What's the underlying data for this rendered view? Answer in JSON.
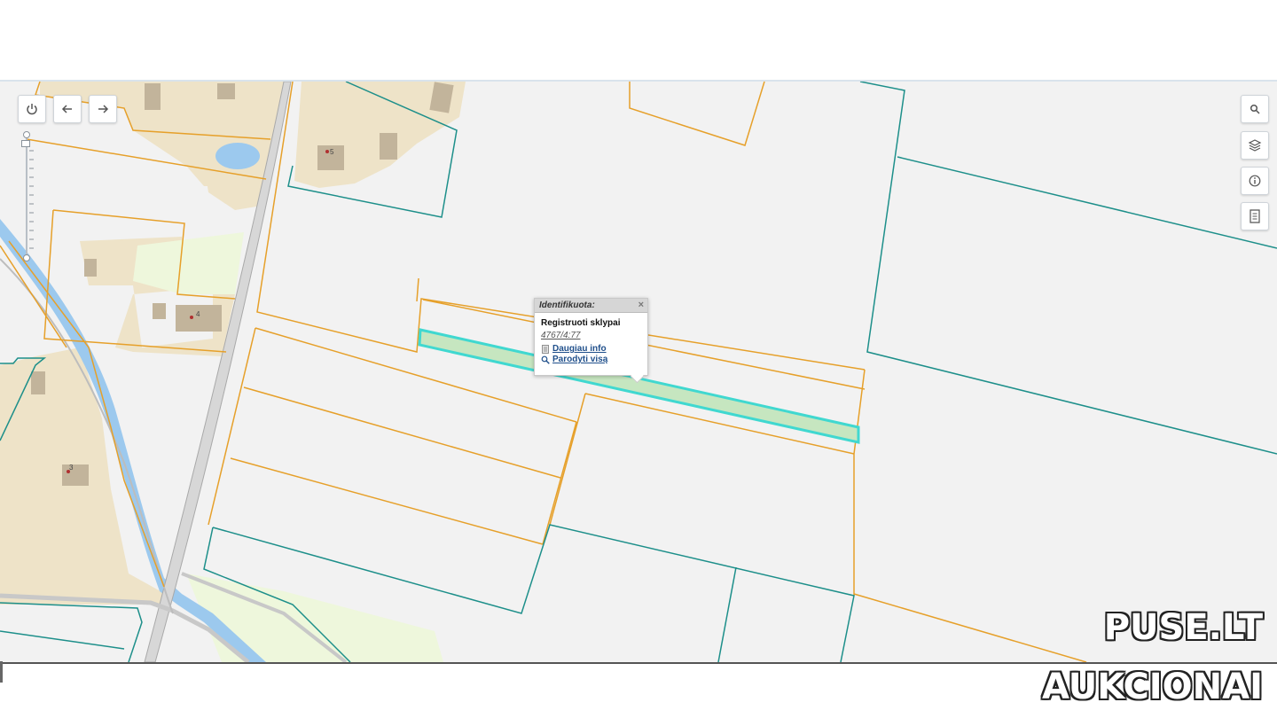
{
  "map": {
    "controls": {
      "power_icon": "power-icon",
      "back_icon": "arrow-left-icon",
      "forward_icon": "arrow-right-icon",
      "search_icon": "search-icon",
      "layers_icon": "layers-icon",
      "info_icon": "info-icon",
      "legend_icon": "document-icon"
    },
    "house_numbers": [
      "5",
      "4",
      "3"
    ],
    "colors": {
      "background": "#f2f2f2",
      "parcel_orange": "#e6a02a",
      "parcel_teal": "#1d8f8a",
      "water": "#9cc9ee",
      "built_area": "#eee3c8",
      "building": "#c2b49b",
      "green": "#eef7dc",
      "selected_fill": "#c6e6c0",
      "selected_stroke": "#40d8d0"
    }
  },
  "popup": {
    "title": "Identifikuota:",
    "close": "×",
    "layer": "Registruoti sklypai",
    "parcel_id": "4767/4:77",
    "more_info": "Daugiau info",
    "show_all": "Parodyti visą"
  },
  "watermark": {
    "line1": "PUSE.LT",
    "line2": "AUKCIONAI"
  }
}
